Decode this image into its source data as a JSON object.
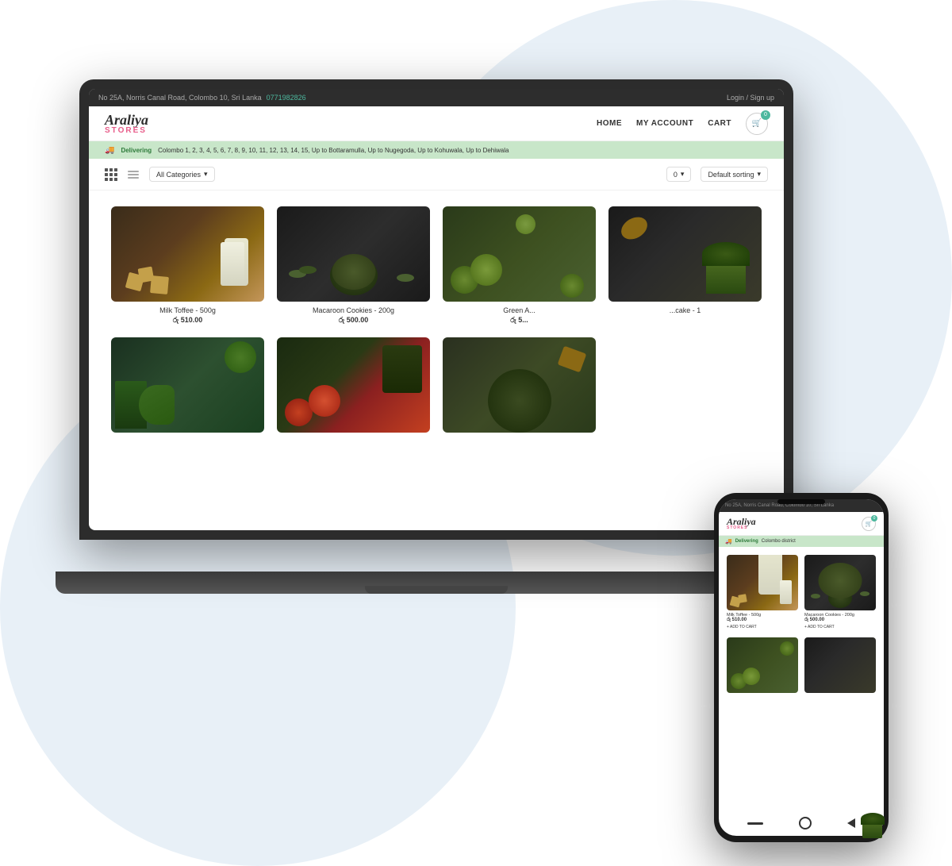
{
  "page": {
    "background_blobs": true
  },
  "topbar": {
    "address": "No 25A, Norris Canal Road, Colombo 10, Sri Lanka",
    "phone": "0771982826",
    "login_text": "Login / Sign up"
  },
  "navbar": {
    "brand_name": "Araliya",
    "brand_stores": "STORES",
    "nav_items": [
      {
        "label": "HOME",
        "id": "home"
      },
      {
        "label": "MY ACCOUNT",
        "id": "my-account"
      },
      {
        "label": "CART",
        "id": "cart"
      }
    ],
    "cart_count": "0"
  },
  "delivery_bar": {
    "icon": "🚚",
    "label": "Delivering",
    "text": "Colombo 1, 2, 3, 4, 5, 6, 7, 8, 9, 10, 11, 12, 13, 14, 15, Up to Bottaramulla, Up to Nugegoda, Up to Kohuwala, Up to Dehiwala"
  },
  "filters": {
    "category_label": "All Categories",
    "count_label": "0",
    "sort_label": "Default sorting",
    "chevron": "▾"
  },
  "products": [
    {
      "id": "milk-toffee",
      "name": "Milk Toffee - 500g",
      "price": "රු 510.00",
      "color_class": "food-milk-toffee"
    },
    {
      "id": "macaroon-cookies",
      "name": "Macaroon Cookies - 200g",
      "price": "රු 500.00",
      "color_class": "food-macaroon"
    },
    {
      "id": "green-apple",
      "name": "Green A...",
      "price": "රු 5...",
      "color_class": "food-green-apple"
    },
    {
      "id": "matcha-cake",
      "name": "...cake - 1",
      "price": "",
      "color_class": "food-matcha"
    },
    {
      "id": "greens",
      "name": "",
      "price": "",
      "color_class": "food-greens"
    },
    {
      "id": "tomatoes",
      "name": "",
      "price": "",
      "color_class": "food-tomato"
    },
    {
      "id": "sauce",
      "name": "",
      "price": "",
      "color_class": "food-sauce"
    }
  ],
  "phone": {
    "address": "No 25A, Norris Canal Road, Colombo 10, Sri Lanka",
    "brand_name": "Araliya",
    "brand_stores": "STORES",
    "delivering_label": "Delivering",
    "delivering_area": "Colombo district",
    "products": [
      {
        "id": "milk-toffee-phone",
        "name": "Milk Toffee - 500g",
        "price": "රු 510.00",
        "add_to_cart": "+ ADD TO CART",
        "color_class": "food-milk-toffee"
      },
      {
        "id": "macaroon-phone",
        "name": "Macaroon Cookies - 200g",
        "price": "රු 500.00",
        "add_to_cart": "+ ADD TO CART",
        "color_class": "food-macaroon"
      },
      {
        "id": "green-apple-phone",
        "name": "",
        "price": "",
        "add_to_cart": "",
        "color_class": "food-green-apple"
      },
      {
        "id": "matcha-phone",
        "name": "",
        "price": "",
        "add_to_cart": "",
        "color_class": "food-matcha"
      }
    ]
  }
}
